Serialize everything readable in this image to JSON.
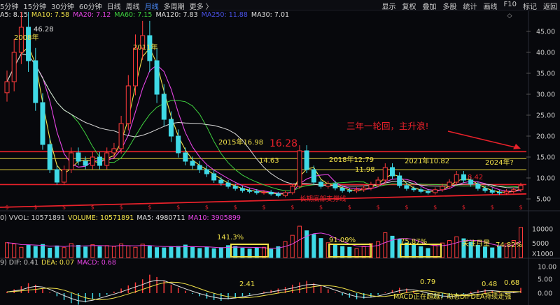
{
  "toolbar": {
    "periods": [
      "5分钟",
      "15分钟",
      "30分钟",
      "60分钟",
      "日线",
      "周线",
      "月线",
      "多周期",
      "更多 〉"
    ],
    "active_period": "月线",
    "actions": [
      "显示",
      "复权",
      "叠加",
      "多股",
      "统计",
      "画线",
      "F10",
      "标记",
      "返回"
    ]
  },
  "ma_legend": [
    {
      "label": "A5: 8.15",
      "color": "#e0e0e0"
    },
    {
      "label": "MA10: 7.58",
      "color": "#f2e34a"
    },
    {
      "label": "MA20: 7.12",
      "color": "#e645e6"
    },
    {
      "label": "MA60: 7.15",
      "color": "#3fd23f"
    },
    {
      "label": "MA120: 7.83",
      "color": "#e0e0e0"
    },
    {
      "label": "MA250: 11.88",
      "color": "#4a52e8"
    },
    {
      "label": "MA30: 7.01",
      "color": "#e0e0e0"
    }
  ],
  "vol_legend": [
    {
      "label": "0) VVOL: 10571891",
      "color": "#d0d0d0"
    },
    {
      "label": "VOLUME: 10571891",
      "color": "#f2e34a"
    },
    {
      "label": "MA5: 4980711",
      "color": "#e0e0e0"
    },
    {
      "label": "MA10: 3905899",
      "color": "#e645e6"
    }
  ],
  "macd_legend": [
    {
      "label": "9) DIF: 0.41",
      "color": "#d0d0d0"
    },
    {
      "label": "DEA: 0.07",
      "color": "#f2e34a"
    },
    {
      "label": "MACD: 0.68",
      "color": "#e645e6"
    }
  ],
  "annotations": {
    "peak_2008_value": "46.28",
    "peak_2008_label": "2008年",
    "peak_2011_label": "2011年",
    "peak_2015": "2015年16.98",
    "line_1628": "16.28",
    "line_1463": "14.63",
    "peak_2018": "2018年12.79",
    "value_1198": "11.98",
    "peak_2021": "2021年10.82",
    "label_2024": "2024年?",
    "value_842": "8.42",
    "support_label": "长期底部支撑线",
    "headline": "三年一轮回，主升浪!",
    "vol_pct_1": "141.3%",
    "vol_pct_2": "91.09%",
    "vol_pct_3": "75.87%",
    "vol_pct_4": "74.82%",
    "vol_focus": "关注月量",
    "vol_unit": "X1000",
    "macd_241": "2.41",
    "macd_079": "0.79",
    "macd_048": "0.48",
    "macd_068": "0.68",
    "macd_note": "MACD正在超越，动态DIFDEA持续走强"
  },
  "chart_data": [
    {
      "type": "candlestick",
      "title": "",
      "period": "月线",
      "y_ticks": [
        5,
        10,
        15,
        20,
        25,
        30,
        35,
        40,
        45
      ],
      "ylim": [
        2.5,
        47.5
      ],
      "grid": false,
      "key_prices": [
        {
          "label": "2008年",
          "value": 46.28
        },
        {
          "label": "2011年",
          "value": 44.5
        },
        {
          "label": "2015年",
          "value": 16.98
        },
        {
          "label": "2018年",
          "value": 12.79
        },
        {
          "label": "2021年",
          "value": 10.82
        }
      ],
      "horizontal_lines": [
        16.28,
        14.63,
        11.98,
        8.42
      ],
      "close_series": [
        33,
        40,
        46,
        38,
        28,
        18,
        12,
        9,
        12,
        16,
        14,
        13,
        15,
        13,
        16,
        17,
        23,
        32,
        41,
        44,
        38,
        30,
        24,
        20,
        16,
        14,
        13,
        12,
        11,
        9.5,
        8.8,
        8,
        7.5,
        7,
        6.8,
        6.5,
        6.6,
        6.2,
        5.8,
        6.5,
        8,
        16.5,
        12,
        9,
        8,
        8.6,
        7.6,
        7,
        6.9,
        7.2,
        7.6,
        8.4,
        9.5,
        12.5,
        10.5,
        8.2,
        7.5,
        7.2,
        6.8,
        6.5,
        7.2,
        8,
        9,
        10.8,
        9.5,
        8.5,
        7.5,
        7,
        6.6,
        6.4,
        6.8,
        7.2,
        8.2
      ]
    },
    {
      "type": "bar",
      "title": "",
      "series": "VOLUME",
      "y_ticks": [
        5000,
        10000
      ],
      "unit": "X1000",
      "values": [
        5.2,
        4.8,
        3.6,
        4.4,
        3.9,
        4.6,
        3.3,
        4.1,
        3.5,
        4.9,
        4.3,
        3.7,
        4.5,
        3.8,
        4.2,
        3.9,
        4.8,
        4.1,
        3.6,
        4.7,
        4,
        3.5,
        3.4,
        3.8,
        3.9,
        4.4,
        3.6,
        3.2,
        3.7,
        3.1,
        3.5,
        4.2,
        3.9,
        3.3,
        3,
        3.4,
        3.6,
        2.9,
        3.8,
        5.6,
        7.8,
        11,
        9.4,
        8.1,
        6.7,
        5.2,
        4.5,
        3.9,
        3.6,
        3.1,
        4,
        4.9,
        5.6,
        8.7,
        7.5,
        6.4,
        5.1,
        4.3,
        3.8,
        3.2,
        4.4,
        5.1,
        6,
        7.3,
        6.6,
        5.4,
        4.3,
        3.7,
        3.4,
        3.9,
        4.8,
        6,
        10.57
      ]
    },
    {
      "type": "bar",
      "title": "",
      "series": "MACD",
      "y_ticks": [
        0,
        5,
        10
      ],
      "values": [
        0.2,
        0.5,
        0.9,
        1.3,
        1.1,
        0.6,
        0.1,
        -0.4,
        -0.9,
        -1.3,
        -1.5,
        -1.2,
        -0.8,
        -0.5,
        -0.2,
        0.2,
        0.6,
        1,
        1.4,
        1.8,
        2.4,
        2.1,
        1.6,
        1.1,
        0.7,
        0.3,
        -0.1,
        -0.4,
        -0.7,
        -0.9,
        -1,
        -0.8,
        -0.6,
        -0.4,
        -0.2,
        0,
        0.2,
        0.4,
        0.6,
        0.8,
        1.1,
        1.4,
        1.6,
        1.3,
        0.9,
        0.5,
        0.1,
        -0.3,
        -0.6,
        -0.8,
        -0.7,
        -0.5,
        -0.2,
        0.1,
        0.4,
        0.7,
        0.6,
        0.3,
        0,
        -0.3,
        -0.5,
        -0.6,
        -0.5,
        -0.3,
        -0.1,
        0.2,
        0.4,
        0.5,
        0.3,
        0.1,
        -0.1,
        0.2,
        0.68
      ]
    }
  ]
}
